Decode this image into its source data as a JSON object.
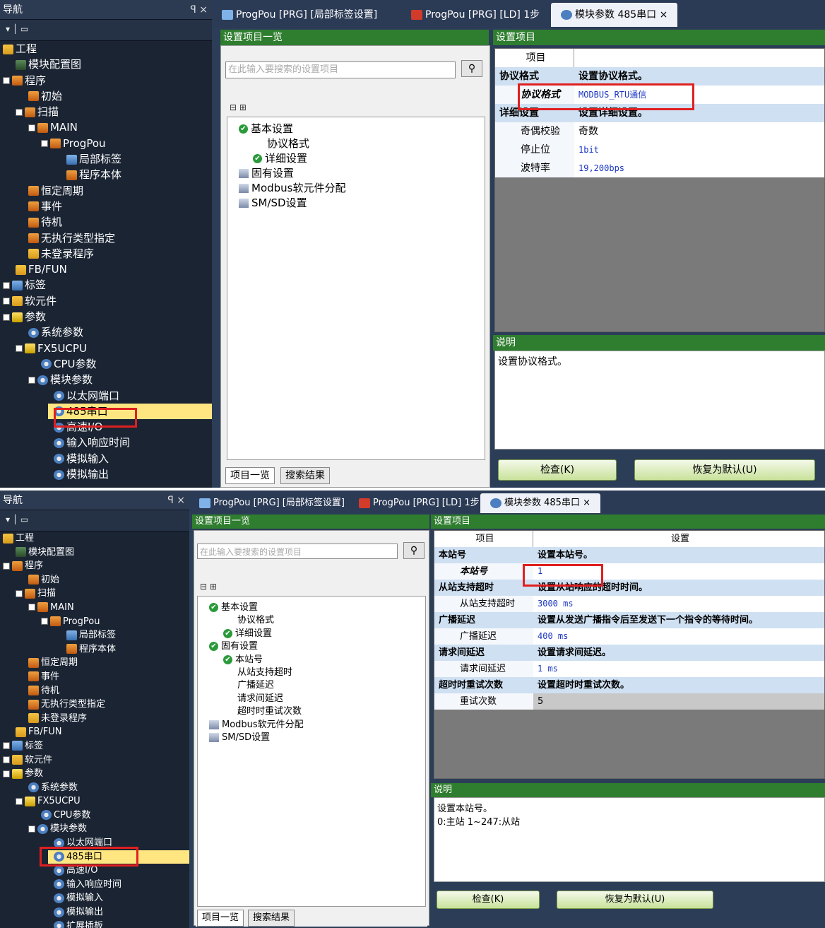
{
  "panel1": {
    "nav": {
      "title": "导航",
      "ctl": "ꟼ ×",
      "tool": "▾ │ ▭",
      "items": [
        {
          "label": "工程",
          "ic": "fld",
          "lv": 0,
          "ex": false
        },
        {
          "label": "模块配置图",
          "ic": "mod",
          "lv": 1,
          "ex": false
        },
        {
          "label": "程序",
          "ic": "prg",
          "lv": 0,
          "ex": true
        },
        {
          "label": "初始",
          "ic": "prg",
          "lv": 2,
          "ex": false
        },
        {
          "label": "扫描",
          "ic": "prg",
          "lv": 1,
          "ex": true
        },
        {
          "label": "MAIN",
          "ic": "prg",
          "lv": 2,
          "ex": true
        },
        {
          "label": "ProgPou",
          "ic": "prg",
          "lv": 3,
          "ex": true
        },
        {
          "label": "局部标签",
          "ic": "tbl",
          "lv": 5,
          "ex": false
        },
        {
          "label": "程序本体",
          "ic": "prg",
          "lv": 5,
          "ex": false
        },
        {
          "label": "恒定周期",
          "ic": "prg",
          "lv": 2,
          "ex": false
        },
        {
          "label": "事件",
          "ic": "prg",
          "lv": 2,
          "ex": false
        },
        {
          "label": "待机",
          "ic": "prg",
          "lv": 2,
          "ex": false
        },
        {
          "label": "无执行类型指定",
          "ic": "prg",
          "lv": 2,
          "ex": false
        },
        {
          "label": "未登录程序",
          "ic": "fld",
          "lv": 2,
          "ex": false
        },
        {
          "label": "FB/FUN",
          "ic": "fld",
          "lv": 1,
          "ex": false
        },
        {
          "label": "标签",
          "ic": "tbl",
          "lv": 0,
          "ex": true
        },
        {
          "label": "软元件",
          "ic": "fld",
          "lv": 0,
          "ex": true
        },
        {
          "label": "参数",
          "ic": "cpu",
          "lv": 0,
          "ex": true
        },
        {
          "label": "系统参数",
          "ic": "gear",
          "lv": 2,
          "ex": false
        },
        {
          "label": "FX5UCPU",
          "ic": "cpu",
          "lv": 1,
          "ex": true
        },
        {
          "label": "CPU参数",
          "ic": "gear",
          "lv": 3,
          "ex": false
        },
        {
          "label": "模块参数",
          "ic": "gear",
          "lv": 2,
          "ex": true
        },
        {
          "label": "以太网端口",
          "ic": "gear",
          "lv": 4,
          "ex": false
        },
        {
          "label": "485串口",
          "ic": "gear",
          "lv": 4,
          "ex": false,
          "sel": true
        },
        {
          "label": "高速I/O",
          "ic": "gear",
          "lv": 4,
          "ex": false
        },
        {
          "label": "输入响应时间",
          "ic": "gear",
          "lv": 4,
          "ex": false
        },
        {
          "label": "模拟输入",
          "ic": "gear",
          "lv": 4,
          "ex": false
        },
        {
          "label": "模拟输出",
          "ic": "gear",
          "lv": 4,
          "ex": false
        }
      ]
    },
    "tabs": [
      "ProgPou [PRG] [局部标签设置]",
      "ProgPou [PRG] [LD] 1步",
      "模块参数 485串口 ×"
    ],
    "list_header": "设置项目一览",
    "search_placeholder": "在此输入要搜索的设置项目",
    "search_icon": "binoculars-icon",
    "settings_tree": [
      {
        "label": "基本设置",
        "lv": 0,
        "t": "chk"
      },
      {
        "label": "协议格式",
        "lv": 2,
        "t": "none"
      },
      {
        "label": "详细设置",
        "lv": 1,
        "t": "chk"
      },
      {
        "label": "固有设置",
        "lv": 0,
        "t": "bk"
      },
      {
        "label": "Modbus软元件分配",
        "lv": 0,
        "t": "bk"
      },
      {
        "label": "SM/SD设置",
        "lv": 0,
        "t": "bk"
      }
    ],
    "bottom_tabs": [
      "项目一览",
      "搜索结果"
    ],
    "settings_header": "设置项目",
    "grid_header": [
      "项目",
      ""
    ],
    "grid_rows": [
      {
        "type": "sec",
        "a": "协议格式",
        "b": "设置协议格式。"
      },
      {
        "type": "item",
        "a": "协议格式",
        "b": "MODBUS_RTU通信",
        "mono": true,
        "italic": true
      },
      {
        "type": "sec",
        "a": "详细设置",
        "b": "设置详细设置。"
      },
      {
        "type": "item",
        "a": "奇偶校验",
        "b": "奇数"
      },
      {
        "type": "item",
        "a": "停止位",
        "b": "1bit",
        "mono": true
      },
      {
        "type": "item",
        "a": "波特率",
        "b": "19,200bps",
        "mono": true
      }
    ],
    "desc_header": "说明",
    "desc_text": "设置协议格式。",
    "btn_check": "检查(K)",
    "btn_default": "恢复为默认(U)"
  },
  "panel2": {
    "nav": {
      "title": "导航",
      "ctl": "ꟼ ×",
      "tool": "▾ │ ▭",
      "items": [
        {
          "label": "工程",
          "ic": "fld",
          "lv": 0,
          "ex": false
        },
        {
          "label": "模块配置图",
          "ic": "mod",
          "lv": 1,
          "ex": false
        },
        {
          "label": "程序",
          "ic": "prg",
          "lv": 0,
          "ex": true
        },
        {
          "label": "初始",
          "ic": "prg",
          "lv": 2,
          "ex": false
        },
        {
          "label": "扫描",
          "ic": "prg",
          "lv": 1,
          "ex": true
        },
        {
          "label": "MAIN",
          "ic": "prg",
          "lv": 2,
          "ex": true
        },
        {
          "label": "ProgPou",
          "ic": "prg",
          "lv": 3,
          "ex": true
        },
        {
          "label": "局部标签",
          "ic": "tbl",
          "lv": 5,
          "ex": false
        },
        {
          "label": "程序本体",
          "ic": "prg",
          "lv": 5,
          "ex": false
        },
        {
          "label": "恒定周期",
          "ic": "prg",
          "lv": 2,
          "ex": false
        },
        {
          "label": "事件",
          "ic": "prg",
          "lv": 2,
          "ex": false
        },
        {
          "label": "待机",
          "ic": "prg",
          "lv": 2,
          "ex": false
        },
        {
          "label": "无执行类型指定",
          "ic": "prg",
          "lv": 2,
          "ex": false
        },
        {
          "label": "未登录程序",
          "ic": "fld",
          "lv": 2,
          "ex": false
        },
        {
          "label": "FB/FUN",
          "ic": "fld",
          "lv": 1,
          "ex": false
        },
        {
          "label": "标签",
          "ic": "tbl",
          "lv": 0,
          "ex": true
        },
        {
          "label": "软元件",
          "ic": "fld",
          "lv": 0,
          "ex": true
        },
        {
          "label": "参数",
          "ic": "cpu",
          "lv": 0,
          "ex": true
        },
        {
          "label": "系统参数",
          "ic": "gear",
          "lv": 2,
          "ex": false
        },
        {
          "label": "FX5UCPU",
          "ic": "cpu",
          "lv": 1,
          "ex": true
        },
        {
          "label": "CPU参数",
          "ic": "gear",
          "lv": 3,
          "ex": false
        },
        {
          "label": "模块参数",
          "ic": "gear",
          "lv": 2,
          "ex": true
        },
        {
          "label": "以太网端口",
          "ic": "gear",
          "lv": 4,
          "ex": false
        },
        {
          "label": "485串口",
          "ic": "gear",
          "lv": 4,
          "ex": false,
          "sel": true
        },
        {
          "label": "高速I/O",
          "ic": "gear",
          "lv": 4,
          "ex": false
        },
        {
          "label": "输入响应时间",
          "ic": "gear",
          "lv": 4,
          "ex": false
        },
        {
          "label": "模拟输入",
          "ic": "gear",
          "lv": 4,
          "ex": false
        },
        {
          "label": "模拟输出",
          "ic": "gear",
          "lv": 4,
          "ex": false
        },
        {
          "label": "扩展插板",
          "ic": "gear",
          "lv": 4,
          "ex": false
        }
      ]
    },
    "tabs": [
      "ProgPou [PRG] [局部标签设置]",
      "ProgPou [PRG] [LD] 1步",
      "模块参数 485串口 ×"
    ],
    "list_header": "设置项目一览",
    "search_placeholder": "在此输入要搜索的设置项目",
    "search_icon": "binoculars-icon",
    "settings_tree": [
      {
        "label": "基本设置",
        "lv": 0,
        "t": "chk"
      },
      {
        "label": "协议格式",
        "lv": 2,
        "t": "none"
      },
      {
        "label": "详细设置",
        "lv": 1,
        "t": "chk"
      },
      {
        "label": "固有设置",
        "lv": 0,
        "t": "chk"
      },
      {
        "label": "本站号",
        "lv": 1,
        "t": "chk"
      },
      {
        "label": "从站支持超时",
        "lv": 2,
        "t": "none"
      },
      {
        "label": "广播延迟",
        "lv": 2,
        "t": "none"
      },
      {
        "label": "请求间延迟",
        "lv": 2,
        "t": "none"
      },
      {
        "label": "超时时重试次数",
        "lv": 2,
        "t": "none"
      },
      {
        "label": "Modbus软元件分配",
        "lv": 0,
        "t": "bk"
      },
      {
        "label": "SM/SD设置",
        "lv": 0,
        "t": "bk"
      }
    ],
    "bottom_tabs": [
      "项目一览",
      "搜索结果"
    ],
    "settings_header": "设置项目",
    "grid_header": [
      "项目",
      "设置"
    ],
    "grid_rows": [
      {
        "type": "sec",
        "a": "本站号",
        "b": "设置本站号。"
      },
      {
        "type": "item",
        "a": "本站号",
        "b": "1",
        "mono": true,
        "italic": true
      },
      {
        "type": "sec",
        "a": "从站支持超时",
        "b": "设置从站响应的超时时间。"
      },
      {
        "type": "item",
        "a": "从站支持超时",
        "b": "3000 ms",
        "mono": true
      },
      {
        "type": "sec",
        "a": "广播延迟",
        "b": "设置从发送广播指令后至发送下一个指令的等待时间。"
      },
      {
        "type": "item",
        "a": "广播延迟",
        "b": "400 ms",
        "mono": true
      },
      {
        "type": "sec",
        "a": "请求间延迟",
        "b": "设置请求间延迟。"
      },
      {
        "type": "item",
        "a": "请求间延迟",
        "b": "1 ms",
        "mono": true
      },
      {
        "type": "sec",
        "a": "超时时重试次数",
        "b": "设置超时时重试次数。"
      },
      {
        "type": "item",
        "a": "重试次数",
        "b": "5",
        "gray": true
      }
    ],
    "desc_header": "说明",
    "desc_text": "设置本站号。",
    "desc_text2": "0:主站 1~247:从站",
    "btn_check": "检查(K)",
    "btn_default": "恢复为默认(U)"
  }
}
